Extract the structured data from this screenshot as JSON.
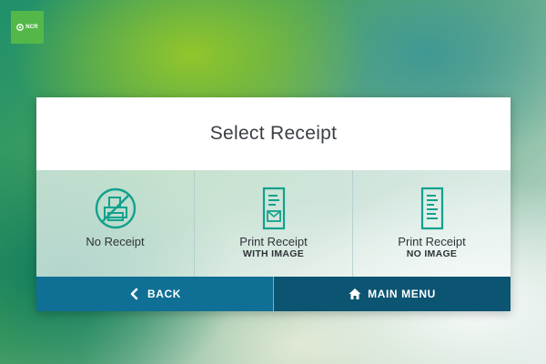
{
  "brand": {
    "logo_text": "NCR",
    "logo_color": "#54b848"
  },
  "dialog": {
    "title": "Select Receipt"
  },
  "options": [
    {
      "label": "No Receipt",
      "sublabel": "",
      "icon": "no-printer-icon"
    },
    {
      "label": "Print Receipt",
      "sublabel": "WITH IMAGE",
      "icon": "receipt-with-image-icon"
    },
    {
      "label": "Print Receipt",
      "sublabel": "NO IMAGE",
      "icon": "receipt-icon"
    }
  ],
  "footer": {
    "back_label": "BACK",
    "back_icon": "chevron-left-icon",
    "main_menu_label": "MAIN MENU",
    "main_menu_icon": "home-icon"
  },
  "colors": {
    "accent_icon": "#12a18e",
    "back_button": "#0f6f95",
    "main_menu_button": "#0b5472"
  }
}
